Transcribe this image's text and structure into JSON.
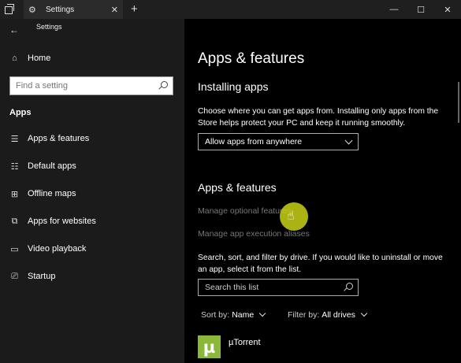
{
  "window": {
    "tab_title": "Settings",
    "new_tab_glyph": "+",
    "tab_close_glyph": "✕",
    "gear_glyph": "⚙",
    "minimize_glyph": "—",
    "maximize_glyph": "☐",
    "close_glyph": "✕"
  },
  "sidebar": {
    "back_glyph": "←",
    "title": "Settings",
    "home_label": "Home",
    "home_glyph": "⌂",
    "search_placeholder": "Find a setting",
    "section_title": "Apps",
    "items": [
      {
        "label": "Apps & features",
        "icon": "apps-features-icon",
        "glyph": "☰"
      },
      {
        "label": "Default apps",
        "icon": "default-apps-icon",
        "glyph": "☷"
      },
      {
        "label": "Offline maps",
        "icon": "map-icon",
        "glyph": "⊞"
      },
      {
        "label": "Apps for websites",
        "icon": "website-icon",
        "glyph": "⧉"
      },
      {
        "label": "Video playback",
        "icon": "video-icon",
        "glyph": "▭"
      },
      {
        "label": "Startup",
        "icon": "startup-icon",
        "glyph": "⎚"
      }
    ]
  },
  "main": {
    "page_title": "Apps & features",
    "installing_heading": "Installing apps",
    "installing_desc": "Choose where you can get apps from. Installing only apps from the Store helps protect your PC and keep it running smoothly.",
    "install_source_value": "Allow apps from anywhere",
    "apps_heading": "Apps & features",
    "manage_optional_link": "Manage optional features",
    "manage_aliases_link": "Manage app execution aliases",
    "search_desc": "Search, sort, and filter by drive. If you would like to uninstall or move an app, select it from the list.",
    "list_search_placeholder": "Search this list",
    "sort_label": "Sort by:",
    "sort_value": "Name",
    "filter_label": "Filter by:",
    "filter_value": "All drives",
    "apps": [
      {
        "name": "µTorrent",
        "icon_letter": "µ",
        "icon_color": "#8bb838"
      }
    ]
  },
  "colors": {
    "sidebar_bg": "#1b1b1b",
    "main_bg": "#000000",
    "link_disabled": "#777777",
    "cursor_halo": "#c8d214"
  }
}
